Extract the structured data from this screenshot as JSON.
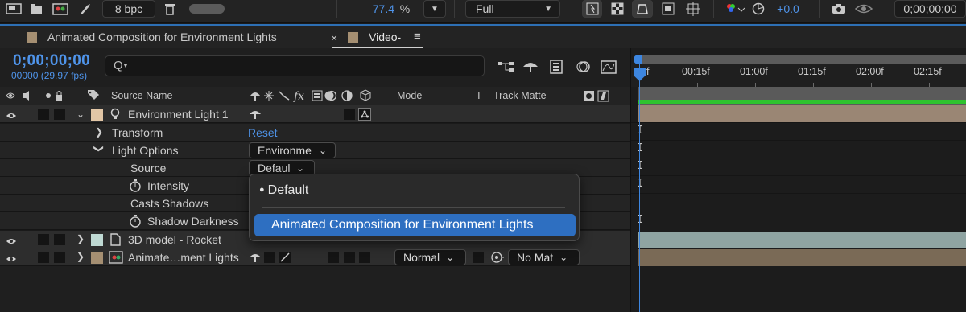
{
  "toolbar": {
    "bpc_label": "8 bpc",
    "zoom_value": "77.4",
    "zoom_unit": "%",
    "resolution_value": "Full",
    "exposure_value": "+0.0",
    "timecode_value": "0;00;00;00"
  },
  "tabs": [
    {
      "label": "Animated Composition for Environment Lights"
    },
    {
      "label": "Video-"
    }
  ],
  "header": {
    "timecode": "0;00;00;00",
    "fps": "00000 (29.97 fps)",
    "search_glyph": "Q"
  },
  "columns": {
    "source_name": "Source Name",
    "mode": "Mode",
    "t": "T",
    "track_matte": "Track Matte"
  },
  "layers": [
    {
      "name": "Environment Light 1",
      "swatch": "#e2c6a6"
    },
    {
      "name": "3D model - Rocket",
      "swatch": "#bfd9d3"
    },
    {
      "name": "Animate…ment Lights",
      "swatch": "#a58f72"
    }
  ],
  "properties": {
    "transform_label": "Transform",
    "transform_value": "Reset",
    "light_options_label": "Light Options",
    "light_options_value": "Environme",
    "source_label": "Source",
    "source_value": "Defaul",
    "intensity_label": "Intensity",
    "casts_shadows_label": "Casts Shadows",
    "shadow_darkness_label": "Shadow Darkness"
  },
  "layer3_controls": {
    "mode_value": "Normal",
    "track_matte_value": "No Mat"
  },
  "timeline": {
    "ticks": [
      "0f",
      "00:15f",
      "01:00f",
      "01:15f",
      "02:00f",
      "02:15f"
    ],
    "keyframe_glyph": "I"
  },
  "popup": {
    "bullet": "●",
    "option_default": "Default",
    "option_selected": "Animated Composition for Environment Lights"
  },
  "colors": {
    "accent": "#3d86e0",
    "selection": "#2e6fc1",
    "track_light": "#9a8674",
    "track_rocket": "#8fa4a2",
    "track_anim": "#7a6a56",
    "work_area_green": "#2ec22e"
  }
}
